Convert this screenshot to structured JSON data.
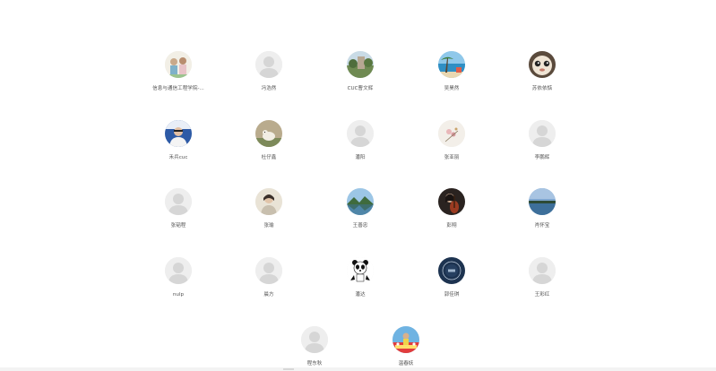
{
  "members": [
    {
      "name": "信息与通信工程学院-...",
      "avatar": "photo-people-icon"
    },
    {
      "name": "冯浩然",
      "avatar": "default-avatar-icon"
    },
    {
      "name": "CUC曹文辉",
      "avatar": "photo-landscape-icon"
    },
    {
      "name": "吴昊然",
      "avatar": "photo-sea-icon"
    },
    {
      "name": "苏依依惦",
      "avatar": "photo-doll-icon"
    },
    {
      "name": "禾兵cuc",
      "avatar": "photo-person-blue-icon"
    },
    {
      "name": "杜仔鑫",
      "avatar": "photo-cat-icon"
    },
    {
      "name": "潘阳",
      "avatar": "default-avatar-icon"
    },
    {
      "name": "张亚丽",
      "avatar": "photo-flower-icon"
    },
    {
      "name": "李鹏辉",
      "avatar": "default-avatar-icon"
    },
    {
      "name": "张韬程",
      "avatar": "default-avatar-icon"
    },
    {
      "name": "张瑜",
      "avatar": "photo-portrait-icon"
    },
    {
      "name": "王善忠",
      "avatar": "photo-lake-icon"
    },
    {
      "name": "彭翔",
      "avatar": "photo-violin-icon"
    },
    {
      "name": "肖怀宝",
      "avatar": "photo-sky-icon"
    },
    {
      "name": "nulp",
      "avatar": "default-avatar-icon"
    },
    {
      "name": "晨方",
      "avatar": "default-avatar-icon"
    },
    {
      "name": "潘达",
      "avatar": "panda-icon"
    },
    {
      "name": "郭佳琪",
      "avatar": "photo-dark-circle-icon"
    },
    {
      "name": "王彩红",
      "avatar": "default-avatar-icon"
    },
    {
      "name": "程东秋",
      "avatar": "default-avatar-icon"
    },
    {
      "name": "温春妖",
      "avatar": "photo-festival-icon"
    }
  ],
  "colors": {
    "default_avatar_bg": "#eeeeee",
    "default_avatar_fg": "#d6d6d6",
    "name_text": "#555555"
  }
}
